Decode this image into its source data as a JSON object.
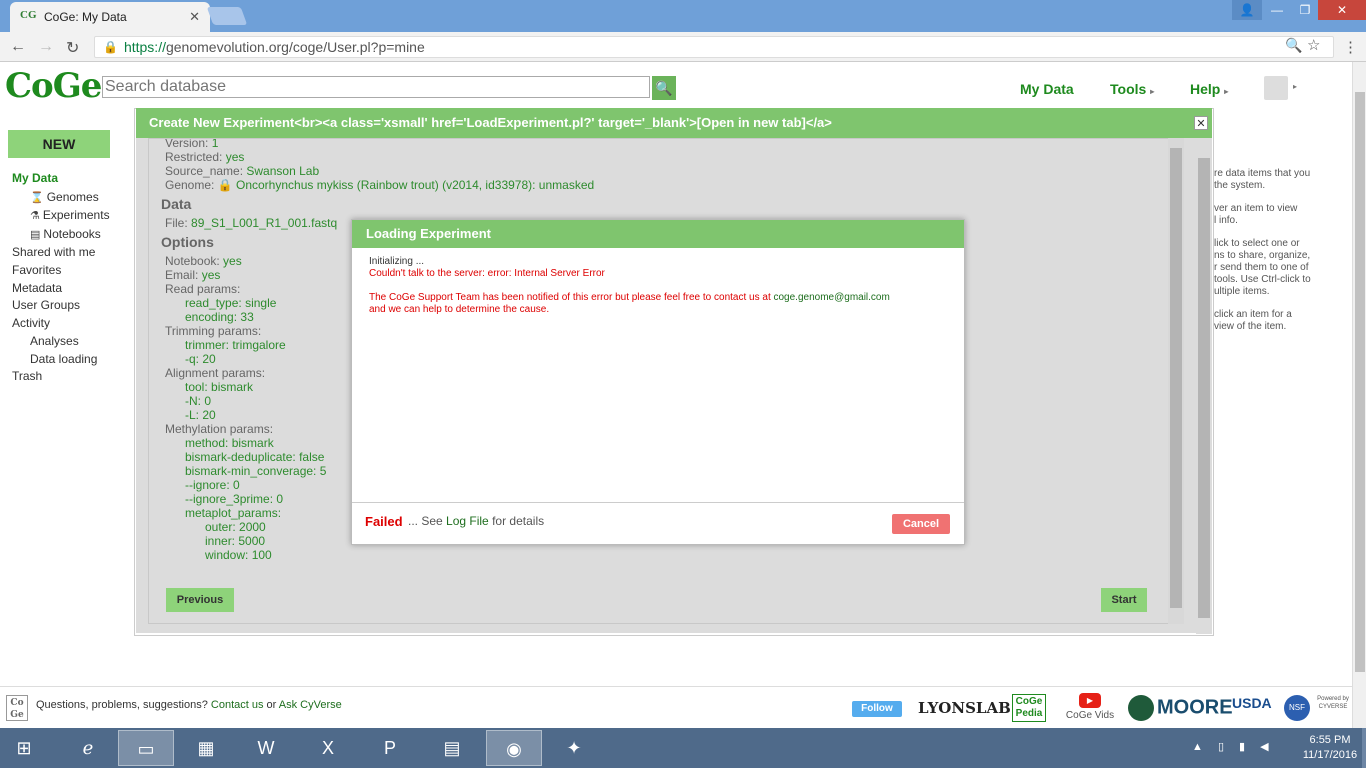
{
  "browser": {
    "tab_title": "CoGe: My Data",
    "tab_favicon": "CG",
    "tab_close": "✕",
    "url_scheme": "https://",
    "url_rest": "genomevolution.org/coge/User.pl?p=mine"
  },
  "header": {
    "logo": "CoGe",
    "search_placeholder": "Search database",
    "nav": {
      "my_data": "My Data",
      "tools": "Tools",
      "help": "Help"
    }
  },
  "sidebar": {
    "new_button": "NEW",
    "my_data": "My Data",
    "genomes": "Genomes",
    "experiments": "Experiments",
    "notebooks": "Notebooks",
    "shared": "Shared with me",
    "favorites": "Favorites",
    "metadata": "Metadata",
    "user_groups": "User Groups",
    "activity": "Activity",
    "analyses": "Analyses",
    "data_loading": "Data loading",
    "trash": "Trash"
  },
  "help_panel": {
    "p1a": "re data items that you",
    "p1b": "the system.",
    "p2a": "ver an item to view",
    "p2b": "l info.",
    "p3a": "lick to select one or",
    "p3b": "ns to share, organize,",
    "p3c": "r send them to one of",
    "p3d": "tools. Use Ctrl-click to",
    "p3e": "ultiple items.",
    "p4a": "click an item for a",
    "p4b": "view of the item."
  },
  "create_dialog": {
    "title": "Create New Experiment<br><a class='xsmall' href='LoadExperiment.pl?' target='_blank'>[Open in new tab]</a>",
    "close": "✕",
    "version_label": "Version:",
    "version_value": "1",
    "restricted_label": "Restricted:",
    "restricted_value": "yes",
    "source_label": "Source_name:",
    "source_value": "Swanson Lab",
    "genome_label": "Genome:",
    "genome_value": "Oncorhynchus mykiss (Rainbow trout) (v2014, id33978): unmasked",
    "data_section": "Data",
    "file_label": "File:",
    "file_value": "89_S1_L001_R1_001.fastq",
    "options_section": "Options",
    "notebook_label": "Notebook:",
    "notebook_value": "yes",
    "email_label": "Email:",
    "email_value": "yes",
    "read_params": "Read params:",
    "read_type_label": "read_type:",
    "read_type_value": "single",
    "encoding_label": "encoding:",
    "encoding_value": "33",
    "trimming_params": "Trimming params:",
    "trimmer_label": "trimmer:",
    "trimmer_value": "trimgalore",
    "q_label": "-q:",
    "q_value": "20",
    "alignment_params": "Alignment params:",
    "tool_label": "tool:",
    "tool_value": "bismark",
    "n_label": "-N:",
    "n_value": "0",
    "l_label": "-L:",
    "l_value": "20",
    "methylation_params": "Methylation params:",
    "method_label": "method:",
    "method_value": "bismark",
    "dedup_label": "bismark-deduplicate:",
    "dedup_value": "false",
    "mincov_label": "bismark-min_converage:",
    "mincov_value": "5",
    "ignore_label": "--ignore:",
    "ignore_value": "0",
    "ignore3_label": "--ignore_3prime:",
    "ignore3_value": "0",
    "metaplot_label": "metaplot_params:",
    "outer_label": "outer:",
    "outer_value": "2000",
    "inner_label": "inner:",
    "inner_value": "5000",
    "window_label": "window:",
    "window_value": "100",
    "previous_button": "Previous",
    "start_button": "Start"
  },
  "loading_dialog": {
    "title": "Loading Experiment",
    "init": "Initializing ...",
    "error": "Couldn't talk to the server: error: Internal Server Error",
    "support_a": "The CoGe Support Team has been notified of this error but please feel free to contact us at",
    "support_email": "coge.genome@gmail.com",
    "support_b": "and we can help to determine the cause.",
    "status_failed": "Failed",
    "status_mid": "... See",
    "status_link": "Log File",
    "status_end": "for details",
    "cancel_button": "Cancel"
  },
  "footer": {
    "logo": "Co Ge",
    "text_a": "Questions, problems, suggestions?",
    "contact": "Contact us",
    "or": "or",
    "ask": "Ask CyVerse",
    "twitter": "Follow",
    "lyonslab": "LYONSLAB",
    "cogepedia": "CoGe Pedia",
    "cogevids": "CoGe Vids",
    "moore": "MOORE",
    "usda": "USDA",
    "nsf": "NSF",
    "cyverse": "Powered by CYVERSE"
  },
  "taskbar": {
    "time": "6:55 PM",
    "date": "11/17/2016"
  },
  "colors": {
    "coge_green": "#7fc56e",
    "error_red": "#dd0000",
    "taskbar": "#4f6a8a"
  }
}
